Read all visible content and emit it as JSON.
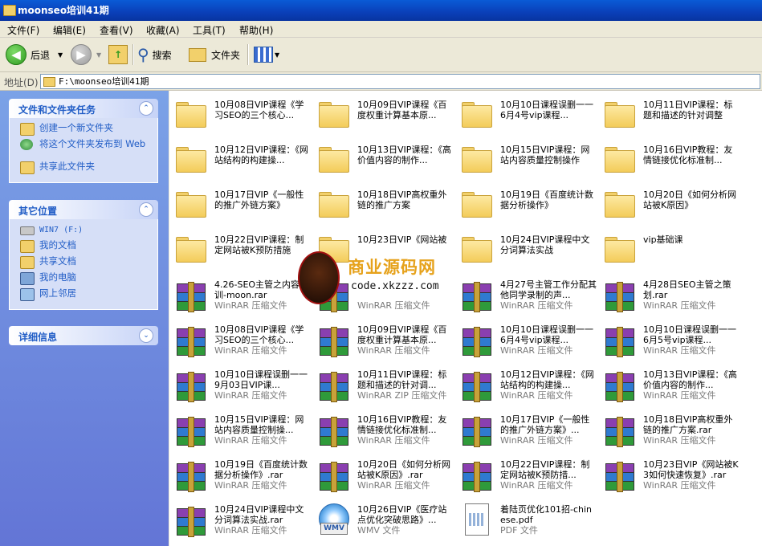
{
  "window": {
    "title": "moonseo培训41期"
  },
  "menu": [
    "文件(F)",
    "编辑(E)",
    "查看(V)",
    "收藏(A)",
    "工具(T)",
    "帮助(H)"
  ],
  "toolbar": {
    "back": "后退",
    "search": "搜索",
    "folders": "文件夹"
  },
  "address": {
    "label": "地址(D)",
    "path": "F:\\moonseo培训41期"
  },
  "sidebar": {
    "tasks_title": "文件和文件夹任务",
    "tasks": [
      "创建一个新文件夹",
      "将这个文件夹发布到 Web",
      "共享此文件夹"
    ],
    "places_title": "其它位置",
    "places": [
      "WIN7 (F:)",
      "我的文档",
      "共享文档",
      "我的电脑",
      "网上邻居"
    ],
    "details_title": "详细信息"
  },
  "files": [
    {
      "name": "10月08日VIP课程《学习SEO的三个核心...",
      "type": "",
      "kind": "folder"
    },
    {
      "name": "10月09日VIP课程《百度权重计算基本原...",
      "type": "",
      "kind": "folder"
    },
    {
      "name": "10月10日课程误删一一6月4号vip课程...",
      "type": "",
      "kind": "folder"
    },
    {
      "name": "10月11日VIP课程：标题和描述的针对调整",
      "type": "",
      "kind": "folder"
    },
    {
      "name": "10月12日VIP课程：《网站结构的构建操...",
      "type": "",
      "kind": "folder"
    },
    {
      "name": "10月13日VIP课程：《高价值内容的制作...",
      "type": "",
      "kind": "folder"
    },
    {
      "name": "10月15日VIP课程：网站内容质量控制操作",
      "type": "",
      "kind": "folder"
    },
    {
      "name": "10月16日VIP教程：友情链接优化标准制...",
      "type": "",
      "kind": "folder"
    },
    {
      "name": "10月17日VIP《一般性的推广外链方案》",
      "type": "",
      "kind": "folder"
    },
    {
      "name": "10月18日VIP高权重外链的推广方案",
      "type": "",
      "kind": "folder"
    },
    {
      "name": "10月19日《百度统计数据分析操作》",
      "type": "",
      "kind": "folder"
    },
    {
      "name": "10月20日《如何分析网站被K原因》",
      "type": "",
      "kind": "folder"
    },
    {
      "name": "10月22日VIP课程：制定网站被K预防措施",
      "type": "",
      "kind": "folder"
    },
    {
      "name": "10月23日VIP《网站被",
      "type": "",
      "kind": "folder"
    },
    {
      "name": "10月24日VIP课程中文分词算法实战",
      "type": "",
      "kind": "folder"
    },
    {
      "name": "vip基础课",
      "type": "",
      "kind": "folder"
    },
    {
      "name": "4.26-SEO主管之内容培训-moon.rar",
      "type": "WinRAR 压缩文件",
      "kind": "rar"
    },
    {
      "name": "",
      "type": "WinRAR 压缩文件",
      "kind": "rar"
    },
    {
      "name": "4月27号主管工作分配其他同学录制的声...",
      "type": "WinRAR 压缩文件",
      "kind": "rar"
    },
    {
      "name": "4月28日SEO主管之策划.rar",
      "type": "WinRAR 压缩文件",
      "kind": "rar"
    },
    {
      "name": "10月08日VIP课程《学习SEO的三个核心...",
      "type": "WinRAR 压缩文件",
      "kind": "rar"
    },
    {
      "name": "10月09日VIP课程《百度权重计算基本原...",
      "type": "WinRAR 压缩文件",
      "kind": "rar"
    },
    {
      "name": "10月10日课程误删一一6月4号vip课程...",
      "type": "WinRAR 压缩文件",
      "kind": "rar"
    },
    {
      "name": "10月10日课程误删一一6月5号vip课程...",
      "type": "WinRAR 压缩文件",
      "kind": "rar"
    },
    {
      "name": "10月10日课程误删一一9月03日VIP课...",
      "type": "WinRAR 压缩文件",
      "kind": "rar"
    },
    {
      "name": "10月11日VIP课程：标题和描述的针对调...",
      "type": "WinRAR ZIP 压缩文件",
      "kind": "rar"
    },
    {
      "name": "10月12日VIP课程：《网站结构的构建操...",
      "type": "WinRAR 压缩文件",
      "kind": "rar"
    },
    {
      "name": "10月13日VIP课程：《高价值内容的制作...",
      "type": "WinRAR 压缩文件",
      "kind": "rar"
    },
    {
      "name": "10月15日VIP课程：网站内容质量控制操...",
      "type": "WinRAR 压缩文件",
      "kind": "rar"
    },
    {
      "name": "10月16日VIP教程：友情链接优化标准制...",
      "type": "WinRAR 压缩文件",
      "kind": "rar"
    },
    {
      "name": "10月17日VIP《一般性的推广外链方案》...",
      "type": "WinRAR 压缩文件",
      "kind": "rar"
    },
    {
      "name": "10月18日VIP高权重外链的推广方案.rar",
      "type": "WinRAR 压缩文件",
      "kind": "rar"
    },
    {
      "name": "10月19日《百度统计数据分析操作》.rar",
      "type": "WinRAR 压缩文件",
      "kind": "rar"
    },
    {
      "name": "10月20日《如何分析网站被K原因》.rar",
      "type": "WinRAR 压缩文件",
      "kind": "rar"
    },
    {
      "name": "10月22日VIP课程：制定网站被K预防措...",
      "type": "WinRAR 压缩文件",
      "kind": "rar"
    },
    {
      "name": "10月23日VIP《网站被K3如何快速恢复》.rar",
      "type": "WinRAR 压缩文件",
      "kind": "rar"
    },
    {
      "name": "10月24日VIP课程中文分词算法实战.rar",
      "type": "WinRAR 压缩文件",
      "kind": "rar"
    },
    {
      "name": "10月26日VIP《医疗站点优化突破思路》...",
      "type": "WMV 文件",
      "kind": "wmv"
    },
    {
      "name": "着陆页优化101招-chinese.pdf",
      "type": "PDF 文件",
      "kind": "pdf"
    }
  ],
  "watermark": {
    "text": "商业源码网",
    "url": "code.xkzzz.com"
  }
}
